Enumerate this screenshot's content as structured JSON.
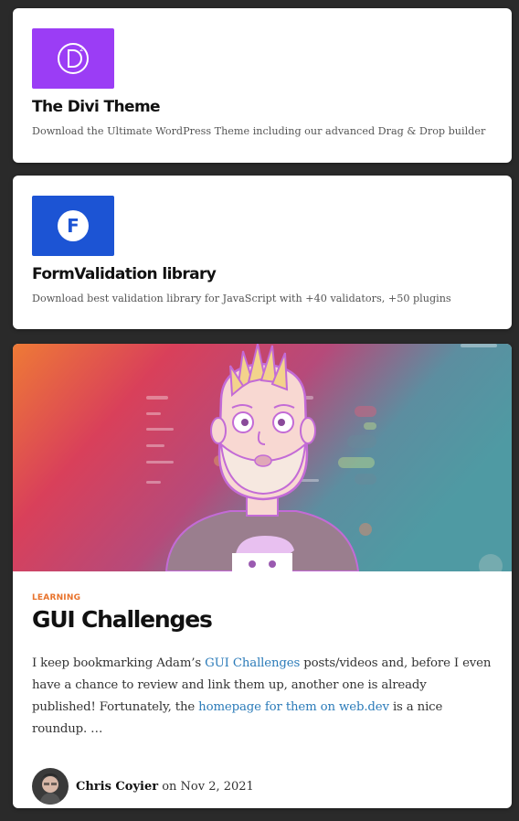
{
  "ads": [
    {
      "title": "The Divi Theme",
      "description": "Download the Ultimate WordPress Theme including our advanced Drag & Drop builder",
      "logo_icon": "divi-logo-icon",
      "logo_color": "#9b3df5"
    },
    {
      "title": "FormValidation library",
      "description": "Download best validation library for JavaScript with +40 validators, +50 plugins",
      "logo_icon": "formvalidation-logo-icon",
      "logo_color": "#1c54d4"
    }
  ],
  "article": {
    "category": "LEARNING",
    "title": "GUI Challenges",
    "excerpt_part1": "I keep bookmarking Adam’s ",
    "link1": "GUI Challenges",
    "excerpt_part2": " posts/videos and, before I even have a chance to review and link them up, another one is already published! Fortunately, the ",
    "link2": "homepage for them on web.dev",
    "excerpt_part3": " is a nice roundup. …",
    "author": "Chris Coyier",
    "on_text": " on ",
    "date": "Nov 2, 2021",
    "link_color": "#2b7bb9",
    "category_color": "#e8732c"
  }
}
